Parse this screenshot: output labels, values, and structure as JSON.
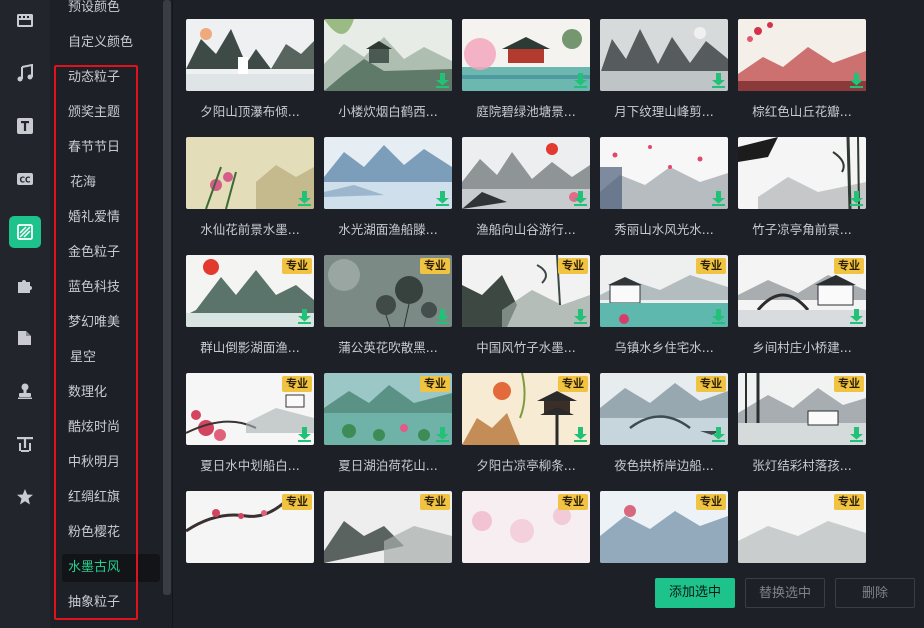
{
  "rail": {
    "icons": [
      "film-icon",
      "music-icon",
      "text-icon",
      "cc-subtitle-icon",
      "background-icon",
      "puzzle-icon",
      "folder-icon",
      "stamp-icon",
      "text-style-icon",
      "star-icon"
    ],
    "active_index": 4,
    "accent": "#1ec28b"
  },
  "categories": {
    "items": [
      "预设颜色",
      "自定义颜色",
      "动态粒子",
      "颁奖主题",
      "春节节日",
      "花海",
      "婚礼爱情",
      "金色粒子",
      "蓝色科技",
      "梦幻唯美",
      "星空",
      "数理化",
      "酷炫时尚",
      "中秋明月",
      "红绸红旗",
      "粉色樱花",
      "水墨古风",
      "抽象粒子"
    ],
    "active": "水墨古风",
    "active_color": "#27d08d"
  },
  "grid": {
    "pro_label": "专业",
    "items": [
      {
        "title": "夕阳山顶瀑布倾...",
        "pro": false,
        "download": false,
        "scene": "waterfall"
      },
      {
        "title": "小楼炊烟白鹤西...",
        "pro": false,
        "download": true,
        "scene": "village"
      },
      {
        "title": "庭院碧绿池塘景...",
        "pro": false,
        "download": true,
        "scene": "garden"
      },
      {
        "title": "月下纹理山峰剪...",
        "pro": false,
        "download": true,
        "scene": "peaks"
      },
      {
        "title": "棕红色山丘花瓣...",
        "pro": false,
        "download": true,
        "scene": "redhills"
      },
      {
        "title": "水仙花前景水墨...",
        "pro": false,
        "download": true,
        "scene": "narcissus"
      },
      {
        "title": "水光湖面渔船滕...",
        "pro": false,
        "download": true,
        "scene": "bluelake"
      },
      {
        "title": "渔船向山谷游行...",
        "pro": false,
        "download": true,
        "scene": "sunvalley"
      },
      {
        "title": "秀丽山水风光水...",
        "pro": false,
        "download": true,
        "scene": "petals"
      },
      {
        "title": "竹子凉亭角前景...",
        "pro": false,
        "download": true,
        "scene": "bamboo"
      },
      {
        "title": "群山倒影湖面渔...",
        "pro": true,
        "download": true,
        "scene": "redsun"
      },
      {
        "title": "蒲公英花吹散黑...",
        "pro": true,
        "download": true,
        "scene": "dandelion"
      },
      {
        "title": "中国风竹子水墨...",
        "pro": true,
        "download": true,
        "scene": "inkbamboo"
      },
      {
        "title": "乌镇水乡住宅水...",
        "pro": true,
        "download": true,
        "scene": "watertown"
      },
      {
        "title": "乡间村庄小桥建...",
        "pro": true,
        "download": true,
        "scene": "bridge"
      },
      {
        "title": "夏日水中划船白...",
        "pro": true,
        "download": true,
        "scene": "blossom"
      },
      {
        "title": "夏日湖泊荷花山...",
        "pro": true,
        "download": true,
        "scene": "lotus"
      },
      {
        "title": "夕阳古凉亭柳条...",
        "pro": true,
        "download": true,
        "scene": "pagoda"
      },
      {
        "title": "夜色拱桥岸边船...",
        "pro": true,
        "download": true,
        "scene": "nightbridge"
      },
      {
        "title": "张灯结彩村落孩...",
        "pro": true,
        "download": true,
        "scene": "lanterns"
      },
      {
        "title": "",
        "pro": true,
        "download": false,
        "scene": "branch"
      },
      {
        "title": "",
        "pro": true,
        "download": false,
        "scene": "mist"
      },
      {
        "title": "",
        "pro": true,
        "download": false,
        "scene": "pinkmist"
      },
      {
        "title": "",
        "pro": true,
        "download": false,
        "scene": "bluemist"
      },
      {
        "title": "",
        "pro": true,
        "download": false,
        "scene": "palemist"
      }
    ]
  },
  "footer": {
    "add_label": "添加选中",
    "replace_label": "替换选中",
    "delete_label": "删除"
  }
}
